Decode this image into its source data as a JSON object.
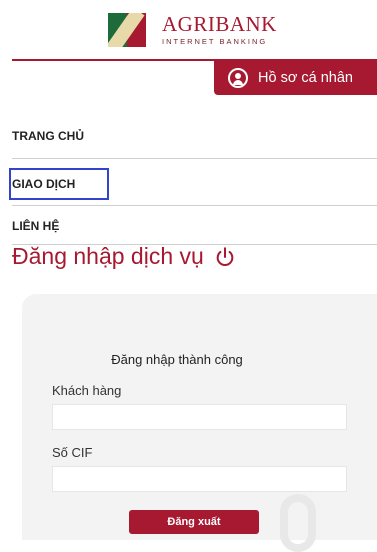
{
  "header": {
    "brand": "AGRIBANK",
    "tagline": "INTERNET BANKING",
    "profile_label": "Hồ sơ cá nhân",
    "brand_color": "#a71930"
  },
  "menu": {
    "items": [
      {
        "label": "TRANG CHỦ"
      },
      {
        "label": "GIAO DỊCH",
        "highlighted": true
      },
      {
        "label": "LIÊN HỆ"
      }
    ]
  },
  "login": {
    "title": "Đăng nhập dịch vụ",
    "status": "Đăng nhập thành công",
    "customer_label": "Khách hàng",
    "customer_value": "",
    "cif_label": "Số CIF",
    "cif_value": "",
    "logout_label": "Đăng xuất"
  },
  "icons": [
    "agribank-logo-icon",
    "user-circle-icon",
    "power-icon"
  ]
}
